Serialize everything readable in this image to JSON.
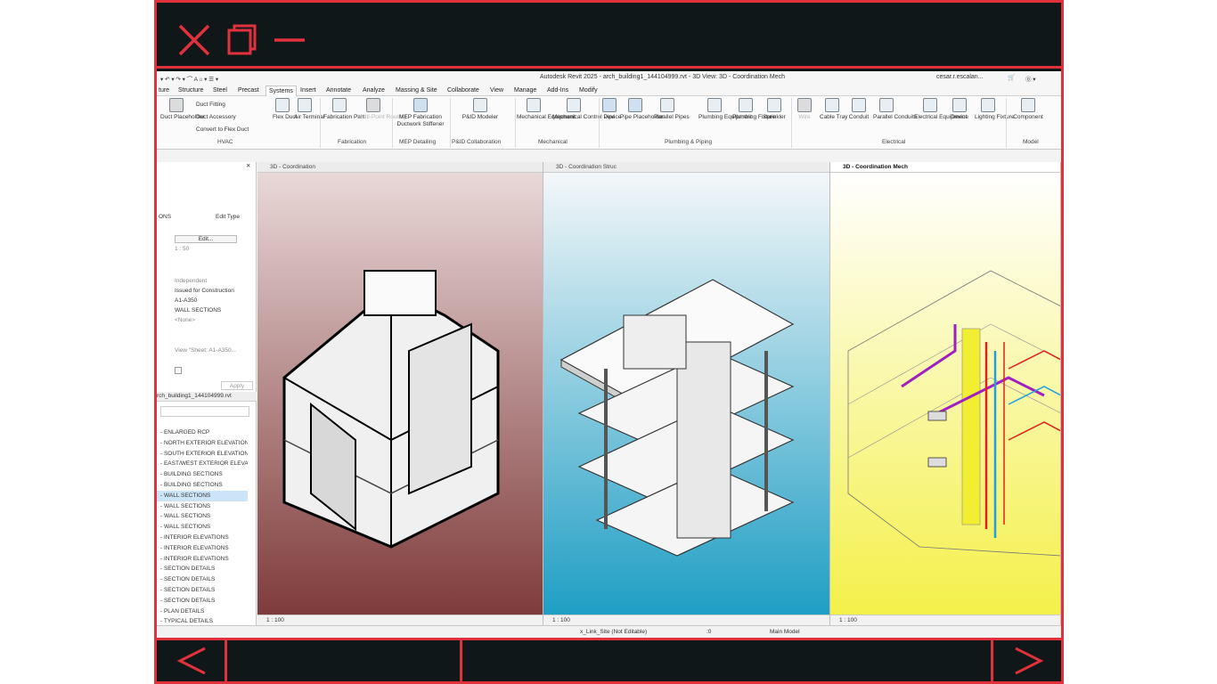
{
  "window": {
    "title": "Autodesk Revit 2025 - arch_building1_144104999.rvt - 3D View: 3D - Coordination Mech",
    "user": "cesar.r.escalan..."
  },
  "tabs": [
    "ture",
    "Structure",
    "Steel",
    "Precast",
    "Systems",
    "Insert",
    "Annotate",
    "Analyze",
    "Massing & Site",
    "Collaborate",
    "View",
    "Manage",
    "Add-Ins",
    "Modify"
  ],
  "active_tab": "Systems",
  "ribbon": {
    "hvac": {
      "duct_placeholder": "Duct Placeholder",
      "duct_fitting": "Duct  Fitting",
      "duct_accessory": "Duct  Accessory",
      "convert_flex": "Convert to  Flex Duct",
      "flex_duct": "Flex Duct",
      "air_terminal": "Air Terminal",
      "group": "HVAC"
    },
    "fabrication": {
      "part": "Fabrication Part",
      "multi_point": "Multi-Point Routing",
      "group": "Fabrication"
    },
    "mep_detailing": {
      "stiffener": "MEP Fabrication Ductwork Stiffener",
      "group": "MEP Detailing"
    },
    "pid": {
      "modeler": "P&ID Modeler",
      "group": "P&ID Collaboration"
    },
    "mechanical": {
      "equipment": "Mechanical Equipment",
      "control": "Mechanical Control Device",
      "group": "Mechanical"
    },
    "plumbing": {
      "pipe": "Pipe",
      "pipe_placeholder": "Pipe Placeholder",
      "parallel_pipes": "Parallel Pipes",
      "plumbing_equipment": "Plumbing Equipment",
      "plumbing_fixture": "Plumbing Fixture",
      "sprinkler": "Sprinkler",
      "group": "Plumbing & Piping"
    },
    "electrical": {
      "wire": "Wire",
      "cable_tray": "Cable Tray",
      "conduit": "Conduit",
      "parallel_conduits": "Parallel Conduits",
      "electrical_equipment": "Electrical Equipment",
      "device": "Device",
      "lighting": "Lighting Fixture",
      "group": "Electrical"
    },
    "model": {
      "component": "Component",
      "group": "Model"
    }
  },
  "properties": {
    "type_label": "ONS",
    "edit_type": "Edit Type",
    "edit_btn": "Edit...",
    "scale": "1 : 50",
    "rows": [
      "Independent",
      "Issued for Construction",
      "A1-A350",
      "WALL SECTIONS",
      "<None>",
      "View \"Sheet: A1-A350..."
    ],
    "apply": "Apply"
  },
  "browser": {
    "title": "rch_building1_144104999.rvt",
    "items": [
      "- ENLARGED RCP",
      "- NORTH EXTERIOR ELEVATION",
      "- SOUTH EXTERIOR ELEVATION",
      "- EAST/WEST EXTERIOR ELEVAT",
      "- BUILDING SECTIONS",
      "- BUILDING SECTIONS",
      "- WALL SECTIONS",
      "- WALL SECTIONS",
      "- WALL SECTIONS",
      "- WALL SECTIONS",
      "- INTERIOR ELEVATIONS",
      "- INTERIOR ELEVATIONS",
      "- INTERIOR ELEVATIONS",
      "- SECTION DETAILS",
      "- SECTION DETAILS",
      "- SECTION DETAILS",
      "- SECTION DETAILS",
      "- PLAN DETAILS",
      "- TYPICAL DETAILS"
    ],
    "selected_index": 6
  },
  "views": [
    {
      "name": "3D - Coordination",
      "scale": "1 : 100",
      "bg_top": "#e9d8d8",
      "bg_bottom": "#7f3b3b"
    },
    {
      "name": "3D - Coordination Struc",
      "scale": "1 : 100",
      "bg_top": "#f4f7f9",
      "bg_bottom": "#1f9ec4"
    },
    {
      "name": "3D - Coordination Mech",
      "scale": "1 : 100",
      "bg_top": "#ffffff",
      "bg_bottom": "#f4f04a"
    }
  ],
  "status": {
    "workset": "x_Link_Site (Not Editable)",
    "count": ":0",
    "model": "Main Model"
  },
  "colors": {
    "frame_red": "#e0313c",
    "frame_dark": "#0f1719"
  }
}
